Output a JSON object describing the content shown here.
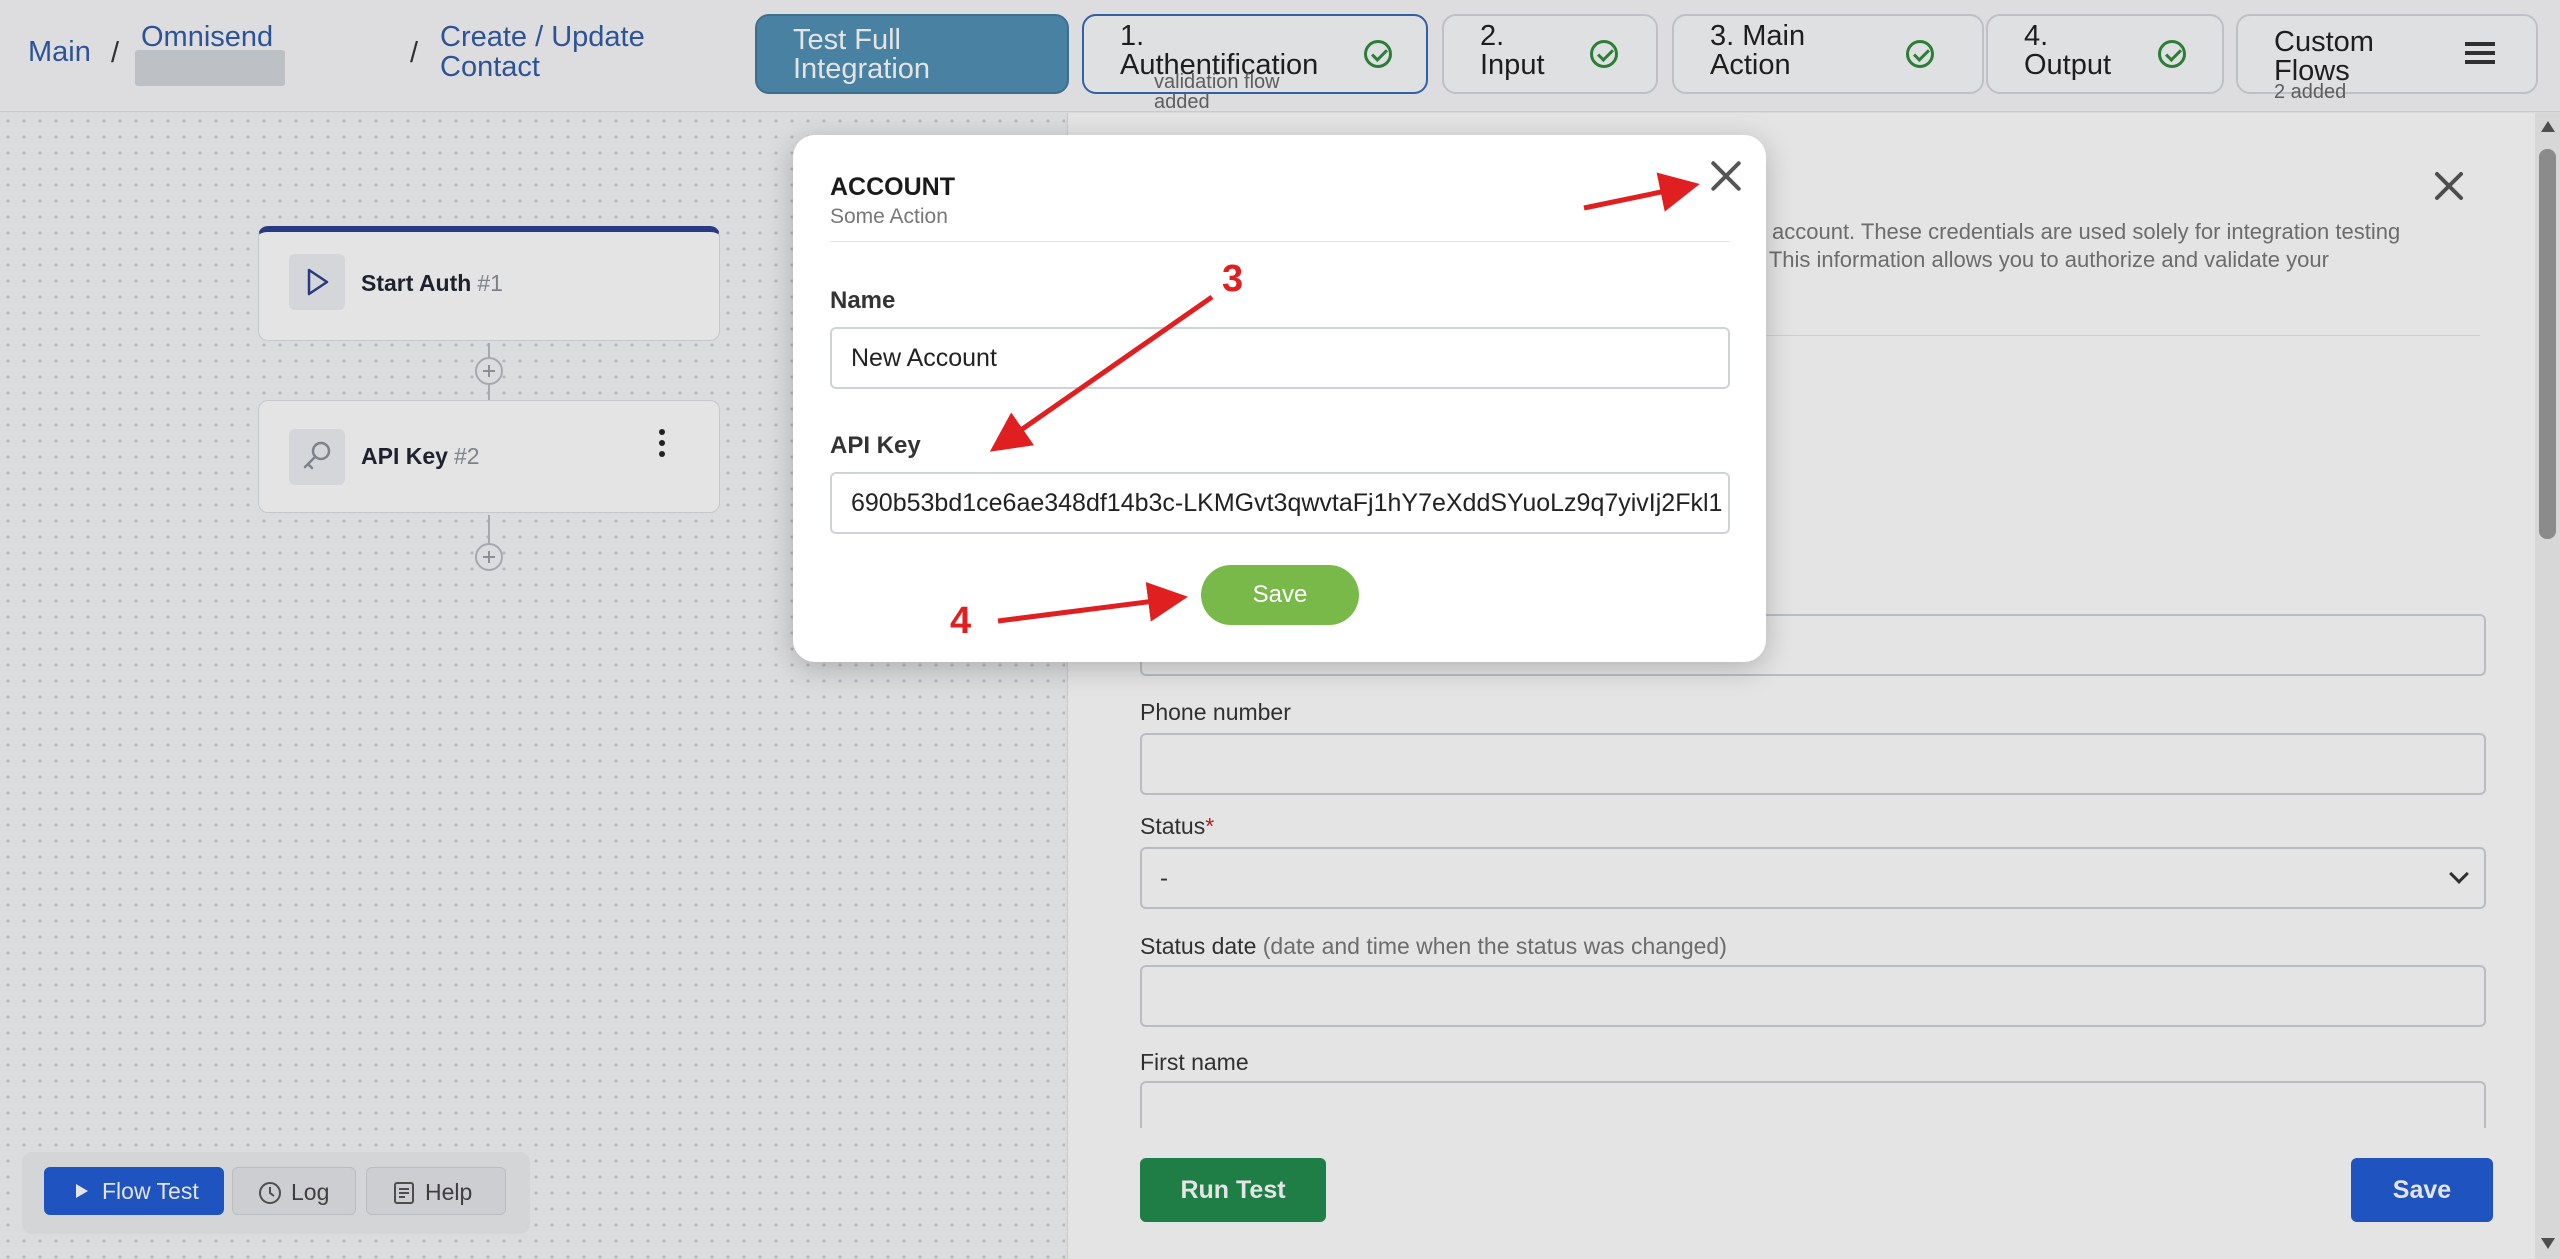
{
  "breadcrumb": {
    "main": "Main",
    "sep1": "/",
    "app": "Omnisend",
    "sep2": "/",
    "action_line1": "Create / Update",
    "action_line2": "Contact"
  },
  "topbar": {
    "test_full": {
      "line1": "Test Full",
      "line2": "Integration"
    },
    "steps": [
      {
        "line1": "1.",
        "line2": "Authentification",
        "sub1": "validation flow",
        "sub2": "added",
        "checked": true
      },
      {
        "line1": "2.",
        "line2": "Input",
        "checked": true
      },
      {
        "line1": "3. Main",
        "line2": "Action",
        "checked": true
      },
      {
        "line1": "4.",
        "line2": "Output",
        "checked": true
      },
      {
        "line1": "Custom",
        "line2": "Flows",
        "sub1": "2 added"
      }
    ],
    "menu_icon": "hamburger-icon"
  },
  "canvas": {
    "nodes": [
      {
        "label": "Start Auth",
        "num": "#1",
        "icon": "play-icon"
      },
      {
        "label": "API Key",
        "num": "#2",
        "icon": "key-icon"
      }
    ],
    "toolbar": {
      "flow_test": "Flow Test",
      "log": "Log",
      "help": "Help"
    }
  },
  "panel": {
    "desc_line1": "account. These credentials are used solely for integration testing",
    "desc_line2": "live. This information allows you to authorize and validate your",
    "fields": {
      "phone": "Phone number",
      "status": "Status",
      "status_required": "*",
      "status_value": "-",
      "status_date": "Status date",
      "status_date_hint": "(date and time when the status was changed)",
      "first_name": "First name"
    },
    "run_test": "Run Test",
    "save": "Save"
  },
  "modal": {
    "title": "ACCOUNT",
    "subtitle": "Some Action",
    "name_label": "Name",
    "name_value": "New Account",
    "api_key_label": "API Key",
    "api_key_value": "690b53bd1ce6ae348df14b3c-LKMGvt3qwvtaFj1hY7eXddSYuoLz9q7yivIj2Fkl1",
    "save": "Save"
  },
  "annotations": {
    "step3": "3",
    "step4": "4"
  },
  "colors": {
    "accent_blue": "#1f5bd6",
    "success_green": "#1f8a4c",
    "modal_save_green": "#79b94a",
    "annotation_red": "#e02020",
    "test_full_bg": "#4e8fb3"
  }
}
